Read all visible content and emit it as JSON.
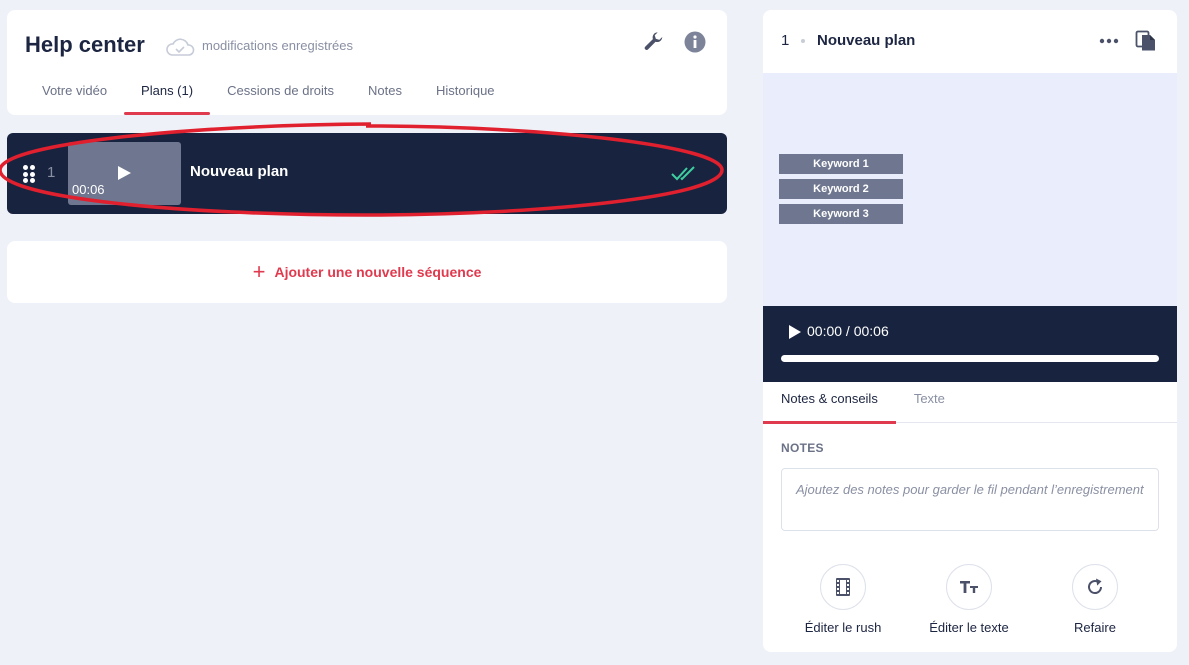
{
  "header": {
    "project_title": "Help center",
    "save_status": "modifications enregistrées"
  },
  "tabs": [
    {
      "label": "Votre vidéo",
      "active": false
    },
    {
      "label": "Plans (1)",
      "active": true
    },
    {
      "label": "Cessions de droits",
      "active": false
    },
    {
      "label": "Notes",
      "active": false
    },
    {
      "label": "Historique",
      "active": false
    }
  ],
  "sequence": {
    "number": "1",
    "duration": "00:06",
    "title": "Nouveau plan"
  },
  "add_sequence": {
    "label": "Ajouter une nouvelle séquence"
  },
  "panel": {
    "number": "1",
    "title": "Nouveau plan",
    "keywords": [
      "Keyword 1",
      "Keyword 2",
      "Keyword 3"
    ],
    "player": {
      "time": "00:00 / 00:06",
      "progress": 0
    },
    "tabs": [
      {
        "label": "Notes & conseils",
        "active": true
      },
      {
        "label": "Texte",
        "active": false
      }
    ],
    "notes_heading": "NOTES",
    "notes_placeholder": "Ajoutez des notes pour garder le fil pendant l’enregistrement",
    "actions": [
      {
        "label": "Éditer le rush",
        "icon": "film-icon"
      },
      {
        "label": "Éditer le texte",
        "icon": "text-format-icon"
      },
      {
        "label": "Refaire",
        "icon": "redo-icon"
      }
    ]
  },
  "colors": {
    "accent": "#e03a4e",
    "navy": "#18243f",
    "check": "#3ecfa0",
    "annotation": "#e0202e"
  }
}
